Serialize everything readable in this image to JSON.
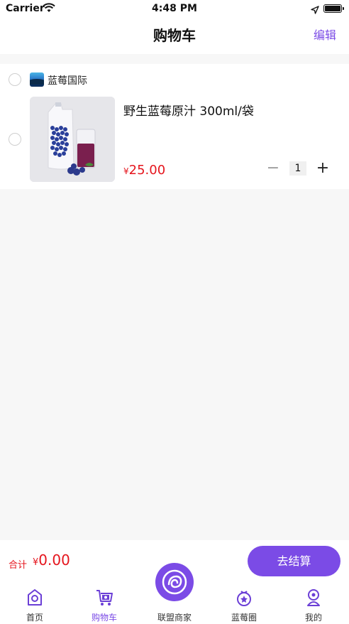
{
  "status": {
    "carrier": "Carrier",
    "time": "4:48 PM"
  },
  "nav": {
    "title": "购物车",
    "edit_label": "编辑"
  },
  "store": {
    "name": "蓝莓国际",
    "item": {
      "title": "野生蓝莓原汁 300ml/袋",
      "price_symbol": "¥",
      "price": "25.00",
      "quantity": "1",
      "minus": "−",
      "plus": "+"
    }
  },
  "checkout": {
    "total_label": "合计",
    "total_symbol": "¥",
    "total_value": "0.00",
    "button_label": "去结算"
  },
  "tabs": [
    {
      "label": "首页",
      "icon": "home-icon"
    },
    {
      "label": "购物车",
      "icon": "cart-icon",
      "active": true
    },
    {
      "label": "联盟商家",
      "icon": "merchant-icon"
    },
    {
      "label": "蓝莓圈",
      "icon": "blueberry-circle-icon"
    },
    {
      "label": "我的",
      "icon": "profile-icon"
    }
  ],
  "colors": {
    "accent": "#7b4be6",
    "price": "#e5151d",
    "background": "#f7f7f7"
  }
}
